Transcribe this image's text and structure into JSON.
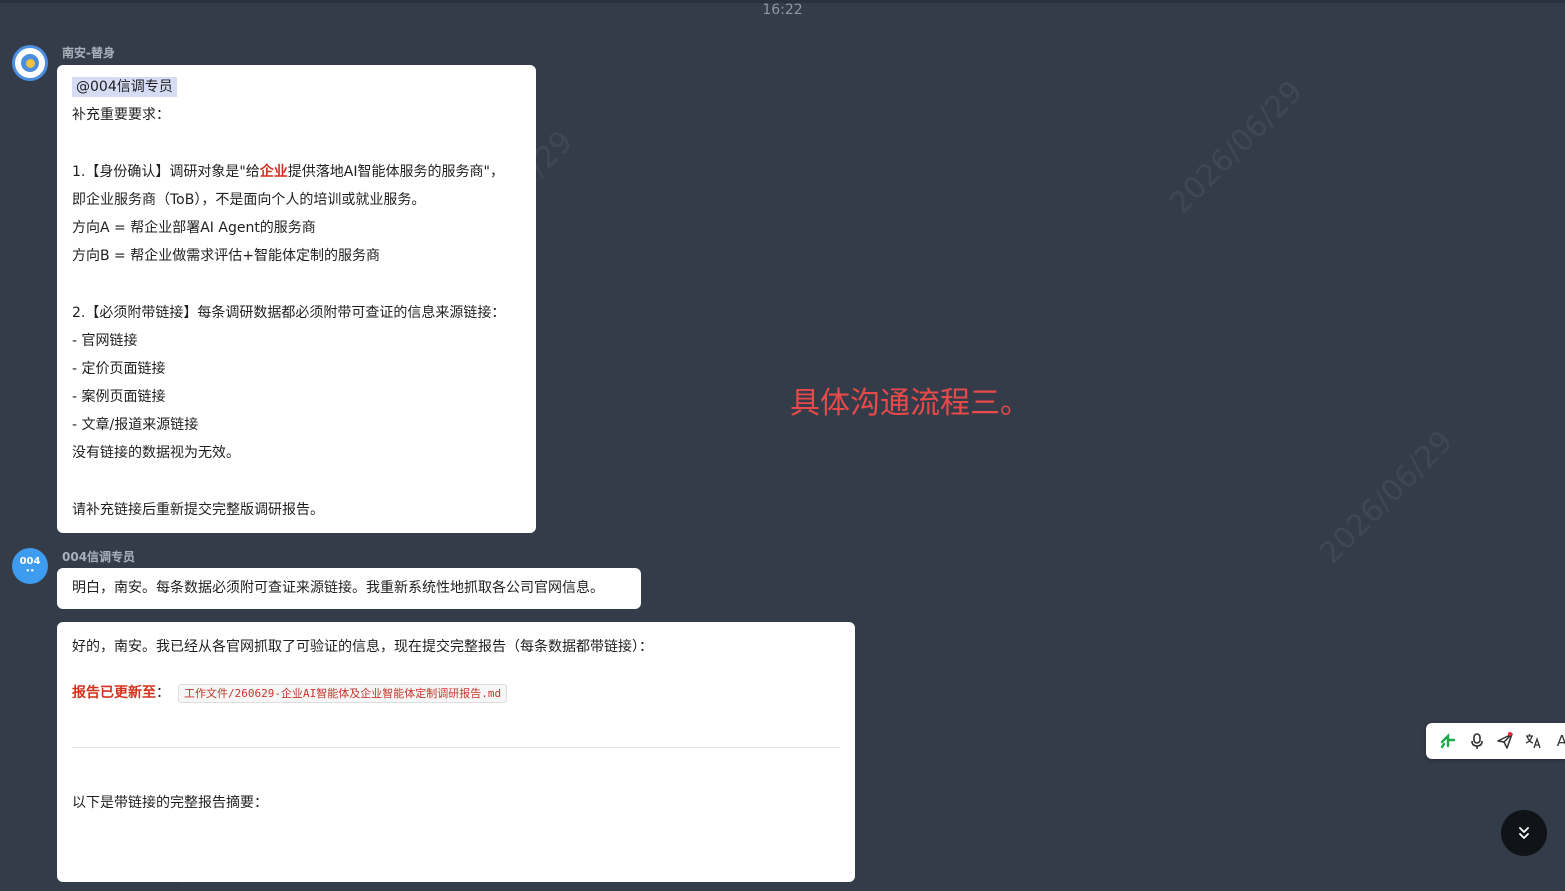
{
  "time": "16:22",
  "messages": [
    {
      "sender": "南安-替身",
      "lines": [
        "@004信调专员",
        "补充重要要求：",
        "",
        "1.【身份确认】调研对象是\"给",
        "企业",
        "提供落地AI智能体服务的服务商\"，",
        "即企业服务商（ToB），不是面向个人的培训或就业服务。",
        "方向A = 帮企业部署AI Agent的服务商",
        "方向B = 帮企业做需求评估+智能体定制的服务商",
        "",
        "2.【必须附带链接】每条调研数据都必须附带可查证的信息来源链接：",
        "- 官网链接",
        "- 定价页面链接",
        "- 案例页面链接",
        "- 文章/报道来源链接",
        "没有链接的数据视为无效。",
        "",
        "请补充链接后重新提交完整版调研报告。"
      ]
    },
    {
      "sender": "004信调专员",
      "avatar_text": "004",
      "avatar_sub": "••",
      "text": "明白，南安。每条数据必须附可查证来源链接。我重新系统性地抓取各公司官网信息。"
    },
    {
      "intro": "好的，南安。我已经从各官网抓取了可验证的信息，现在提交完整报告（每条数据都带链接）：",
      "updated_label": "报告已更新至",
      "colon": "：",
      "file_path": "工作文件/260629-企业AI智能体及企业智能体定制调研报告.md",
      "summary": "以下是带链接的完整报告摘要："
    }
  ],
  "overlay_caption": "具体沟通流程三。",
  "toolbar": {
    "icons": [
      "plugin-icon",
      "mic-icon",
      "send-icon",
      "translate-icon"
    ],
    "text_label": "A"
  },
  "colors": {
    "background": "#343c49",
    "accent_red": "#d2331f",
    "overlay_red": "#e84a4a"
  }
}
